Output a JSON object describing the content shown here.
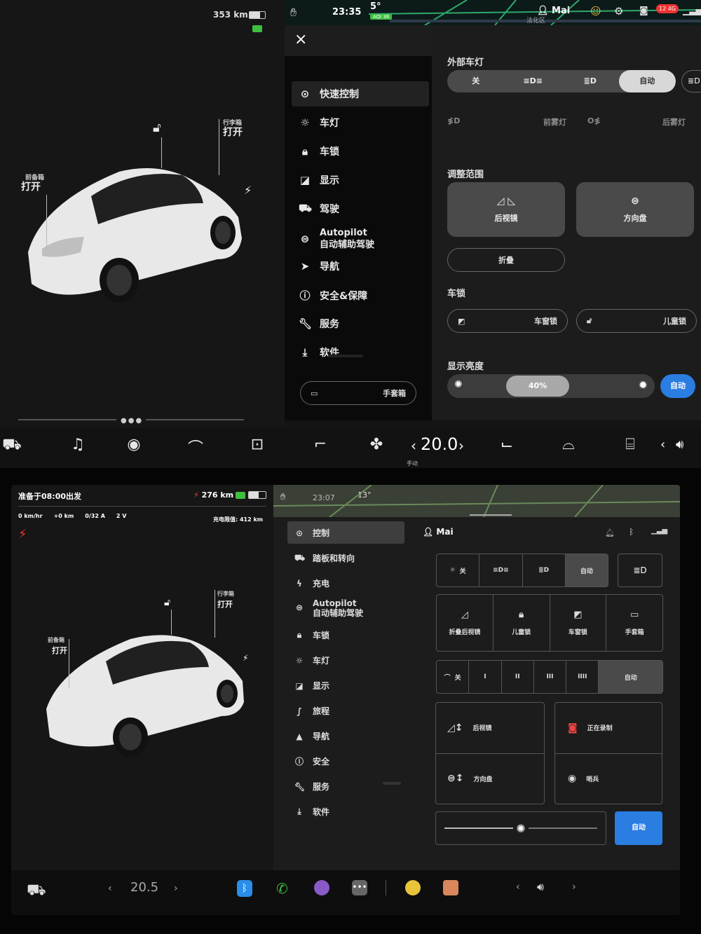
{
  "top": {
    "status": {
      "range": "353 km",
      "time": "23:35",
      "temp": "5°",
      "aqi": "AQI 36",
      "user": "Mai",
      "signal": "12 4G",
      "map_label": "法化区"
    },
    "car_labels": {
      "frunk_small": "前备箱",
      "frunk": "打开",
      "trunk_small": "行李箱",
      "trunk": "打开"
    },
    "menu": {
      "close": "×",
      "items": [
        {
          "icon": "toggle-icon",
          "label": "快速控制"
        },
        {
          "icon": "sun-icon",
          "label": "车灯"
        },
        {
          "icon": "lock-icon",
          "label": "车锁"
        },
        {
          "icon": "display-icon",
          "label": "显示"
        },
        {
          "icon": "car-icon",
          "label": "驾驶"
        },
        {
          "icon": "steering-icon",
          "label": "Autopilot",
          "sub": "自动辅助驾驶"
        },
        {
          "icon": "navigate-icon",
          "label": "导航"
        },
        {
          "icon": "alert-icon",
          "label": "安全&保障"
        },
        {
          "icon": "wrench-icon",
          "label": "服务"
        },
        {
          "icon": "download-icon",
          "label": "软件"
        }
      ],
      "glovebox": "手套箱"
    },
    "panel": {
      "exterior_lights_title": "外部车灯",
      "lights_seg": [
        "关",
        "≡D≡",
        "≣D",
        "自动"
      ],
      "fog_front": "前雾灯",
      "fog_rear": "后雾灯",
      "adjust_title": "调整范围",
      "mirrors": "后视镜",
      "steering": "方向盘",
      "fold": "折叠",
      "locks_title": "车锁",
      "window_lock": "车窗锁",
      "child_lock": "儿童锁",
      "brightness_title": "显示亮度",
      "brightness_value": "40%",
      "brightness_level": 0.4,
      "auto": "自动"
    },
    "dock": {
      "temp": "20.0",
      "temp_mode": "手动"
    }
  },
  "bottom": {
    "status": {
      "depart": "准备于08:00出发",
      "range": "276 km",
      "speed": "0 km/hr",
      "added": "+0 km",
      "current": "0/32 A",
      "voltage": "2 V",
      "charge_limit": "充电限值: 412 km",
      "time": "23:07",
      "temp": "13°"
    },
    "car_labels": {
      "frunk_small": "前备箱",
      "frunk": "打开",
      "trunk_small": "行李箱",
      "trunk": "打开"
    },
    "menu": [
      {
        "icon": "toggle-icon",
        "label": "控制"
      },
      {
        "icon": "car-icon",
        "label": "踏板和转向"
      },
      {
        "icon": "bolt-icon",
        "label": "充电"
      },
      {
        "icon": "steering-icon",
        "label": "Autopilot",
        "sub": "自动辅助驾驶"
      },
      {
        "icon": "lock-icon",
        "label": "车锁"
      },
      {
        "icon": "sun-icon",
        "label": "车灯"
      },
      {
        "icon": "display-icon",
        "label": "显示"
      },
      {
        "icon": "trip-icon",
        "label": "旅程"
      },
      {
        "icon": "navigate-icon",
        "label": "导航"
      },
      {
        "icon": "alert-icon",
        "label": "安全"
      },
      {
        "icon": "wrench-icon",
        "label": "服务"
      },
      {
        "icon": "download-icon",
        "label": "软件"
      }
    ],
    "panel": {
      "user": "Mai",
      "lights": [
        "关",
        "≡D≡",
        "≣D",
        "自动"
      ],
      "actions": [
        "折叠后视镜",
        "儿童锁",
        "车窗锁",
        "手套箱"
      ],
      "wipers": [
        "关",
        "I",
        "II",
        "III",
        "IIII",
        "自动"
      ],
      "mirrors": "后视镜",
      "steering": "方向盘",
      "dashcam": "正在录制",
      "sentry": "哨兵",
      "auto": "自动"
    },
    "dock": {
      "temp": "20.5"
    }
  }
}
